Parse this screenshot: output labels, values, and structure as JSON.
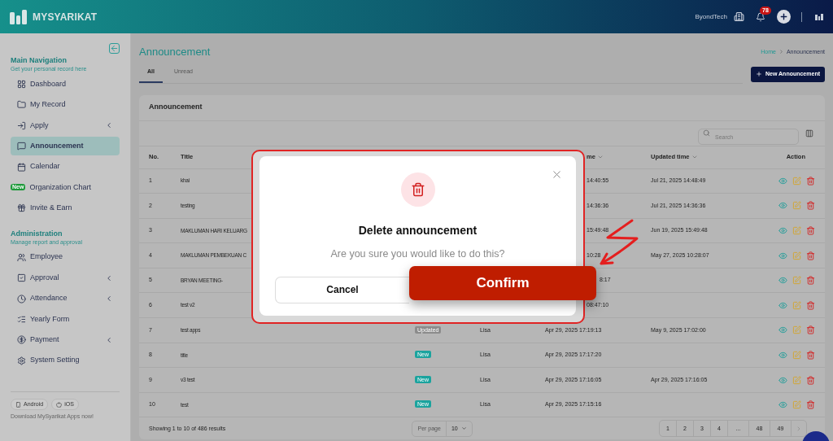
{
  "header": {
    "brand": "MYSYARIKAT",
    "company": "ByondTech",
    "notification_count": "78"
  },
  "sidebar": {
    "sections": [
      {
        "title": "Main Navigation",
        "subtitle": "Get your personal record here",
        "items": [
          {
            "label": "Dashboard",
            "selected": false,
            "has_submenu": false
          },
          {
            "label": "My Record",
            "selected": false,
            "has_submenu": false
          },
          {
            "label": "Apply",
            "selected": false,
            "has_submenu": true
          },
          {
            "label": "Announcement",
            "selected": true,
            "has_submenu": false
          },
          {
            "label": "Calendar",
            "selected": false,
            "has_submenu": false
          },
          {
            "label": "Organization Chart",
            "selected": false,
            "has_submenu": false,
            "badge": "New"
          },
          {
            "label": "Invite & Earn",
            "selected": false,
            "has_submenu": false
          }
        ]
      },
      {
        "title": "Administration",
        "subtitle": "Manage report and approval",
        "items": [
          {
            "label": "Employee",
            "selected": false,
            "has_submenu": false
          },
          {
            "label": "Approval",
            "selected": false,
            "has_submenu": true
          },
          {
            "label": "Attendance",
            "selected": false,
            "has_submenu": true
          },
          {
            "label": "Yearly Form",
            "selected": false,
            "has_submenu": false
          },
          {
            "label": "Payment",
            "selected": false,
            "has_submenu": true
          },
          {
            "label": "System Setting",
            "selected": false,
            "has_submenu": false
          }
        ]
      }
    ],
    "apps": [
      "Android",
      "iOS"
    ],
    "apps_note": "Download MySyarikat Apps now!"
  },
  "page": {
    "title": "Announcement",
    "breadcrumb": [
      "Home",
      "Announcement"
    ],
    "tabs": [
      {
        "label": "All",
        "selected": true
      },
      {
        "label": "Unread",
        "selected": false
      }
    ],
    "new_button": "New Announcement"
  },
  "table": {
    "title": "Announcement",
    "search": {
      "placeholder": "Search"
    },
    "columns": [
      {
        "label": "No.",
        "sortable": false
      },
      {
        "label": "Title",
        "sortable": false
      },
      {
        "label": "me",
        "sortable": true,
        "covered": true
      },
      {
        "label": "Updated time",
        "sortable": true
      },
      {
        "label": "Action",
        "sortable": false
      }
    ],
    "rows": [
      {
        "no": "1",
        "title": "khai",
        "created": "14:40:55",
        "updated": "Jul 21, 2025 14:48:49",
        "covered": true
      },
      {
        "no": "2",
        "title": "testing",
        "created": "14:36:36",
        "updated": "Jul 21, 2025 14:36:36",
        "covered": true
      },
      {
        "no": "3",
        "title": "MAKLUMAN HARI KELUARG",
        "created": "15:49:48",
        "updated": "Jun 19, 2025 15:49:48",
        "covered": true
      },
      {
        "no": "4",
        "title": "MAKLUMAN PEMBEKUAN C",
        "created": "10:28",
        "updated": "May 27, 2025 10:28:07",
        "covered": true
      },
      {
        "no": "5",
        "title": "BRYAN MEETING-",
        "created": "8:17",
        "covered": true
      },
      {
        "no": "6",
        "title": "test v2",
        "created": "08:47:10",
        "covered": true
      },
      {
        "no": "7",
        "title": "test apps",
        "status": {
          "label": "Updated",
          "color": "#8c8c8c"
        },
        "author": "Lisa",
        "created": "Apr 29, 2025 17:19:13",
        "updated": "May 9, 2025 17:02:00"
      },
      {
        "no": "8",
        "title": "title",
        "status": {
          "label": "New",
          "color": "#1aa39e"
        },
        "author": "Lisa",
        "created": "Apr 29, 2025 17:17:20"
      },
      {
        "no": "9",
        "title": "v3 test",
        "status": {
          "label": "New",
          "color": "#1aa39e"
        },
        "author": "Lisa",
        "created": "Apr 29, 2025 17:16:05",
        "updated": "Apr 29, 2025 17:16:05"
      },
      {
        "no": "10",
        "title": "test",
        "status": {
          "label": "New",
          "color": "#1aa39e"
        },
        "author": "Lisa",
        "created": "Apr 29, 2025 17:15:16"
      }
    ],
    "summary": "Showing 1 to 10 of 486 results",
    "per_page_label": "Per page",
    "per_page": "10",
    "pages": [
      "1",
      "2",
      "3",
      "4",
      "...",
      "48",
      "49"
    ]
  },
  "dialog": {
    "title": "Delete announcement",
    "message": "Are you sure you would like to do this?",
    "cancel": "Cancel",
    "confirm": "Confirm"
  }
}
